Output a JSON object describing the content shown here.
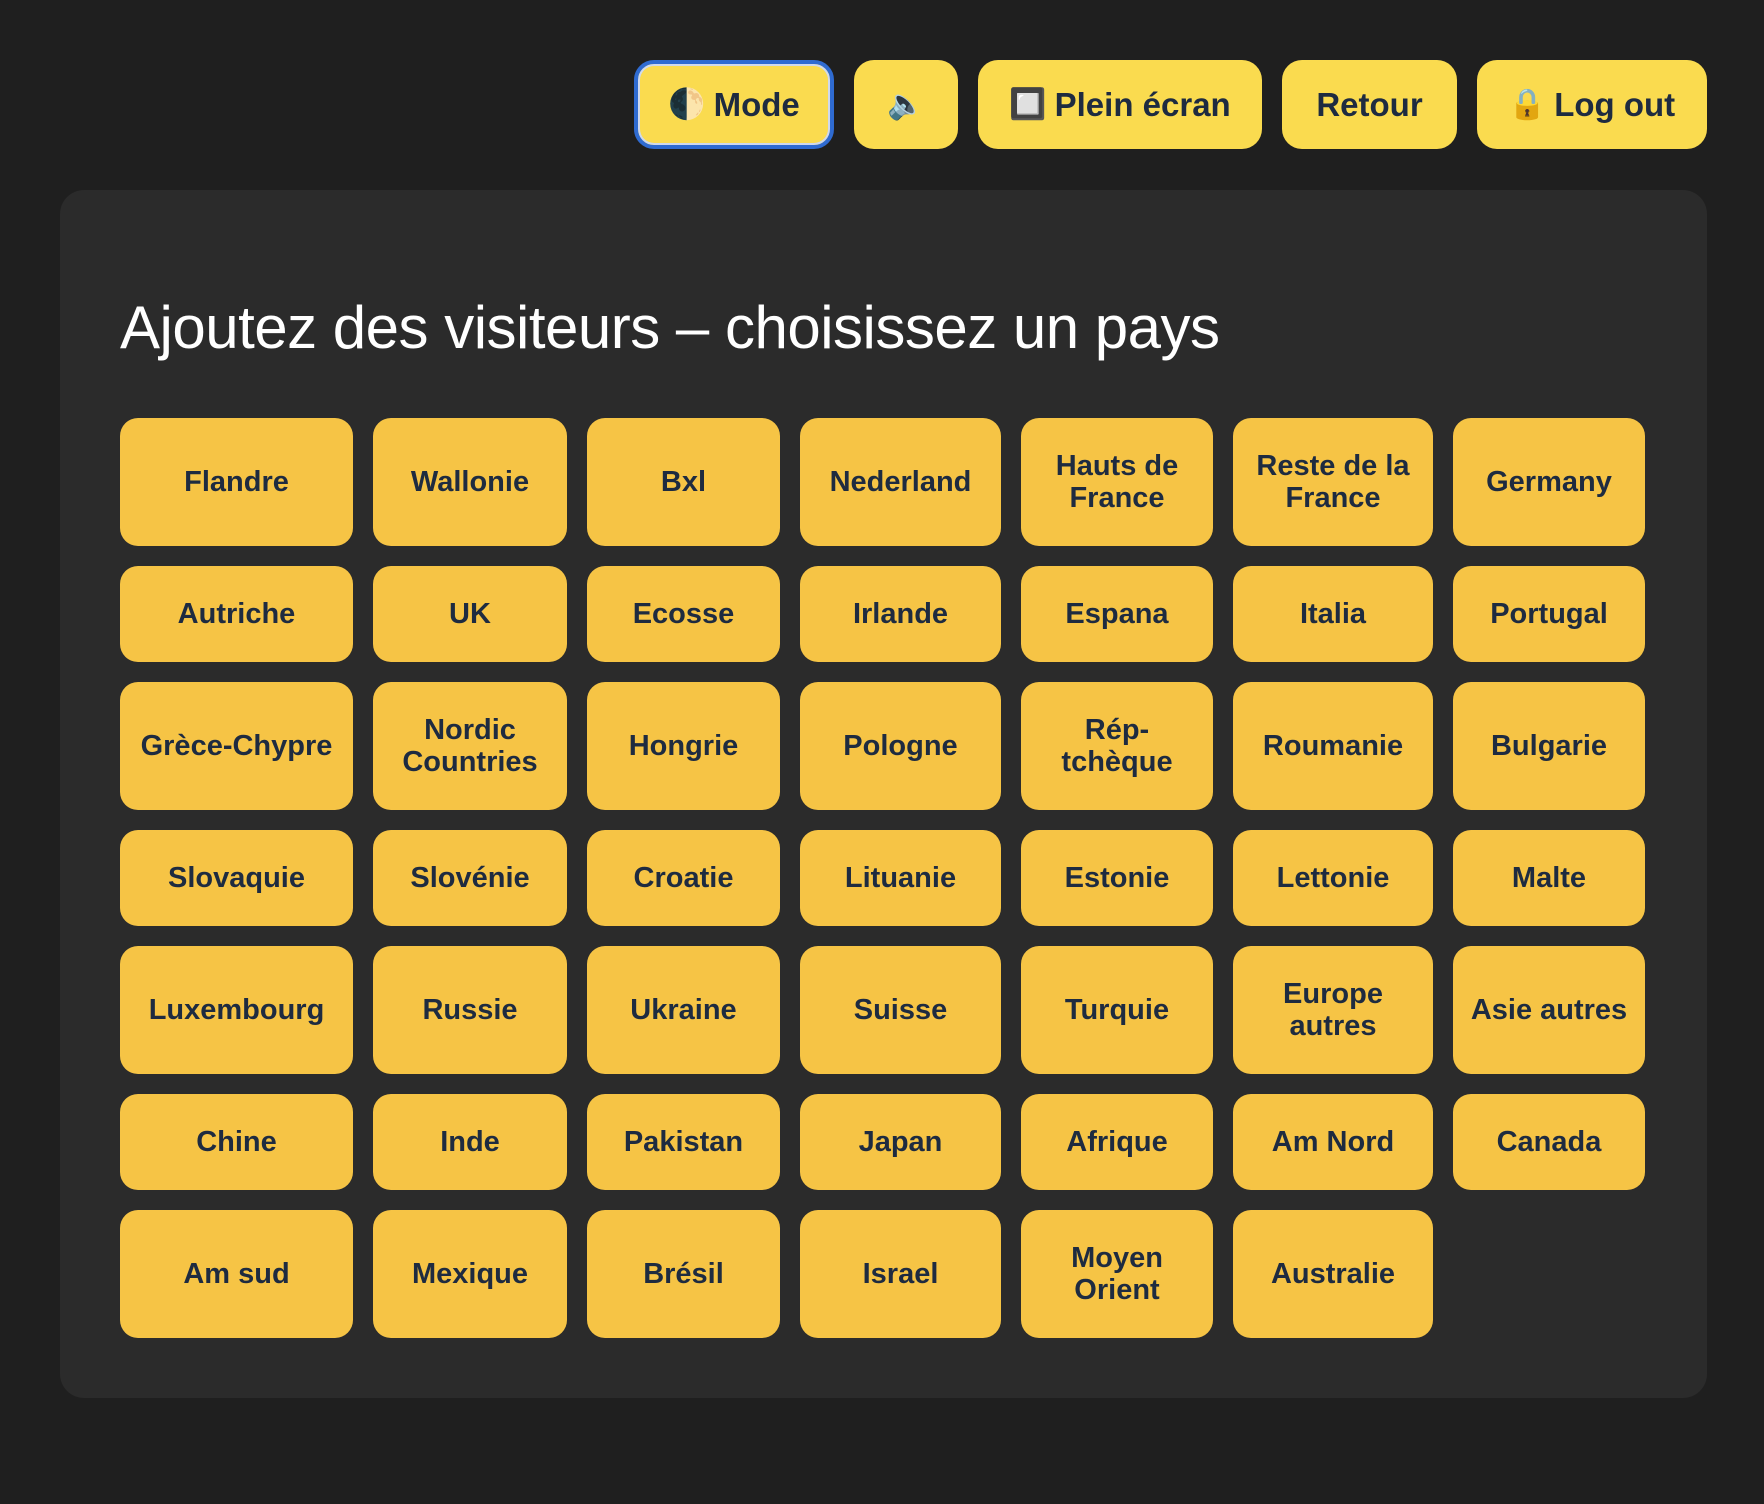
{
  "toolbar": {
    "mode": {
      "icon": "🌓",
      "icon_name": "moon-icon",
      "label": "Mode"
    },
    "sound": {
      "icon": "🔈",
      "icon_name": "speaker-icon"
    },
    "fullscreen": {
      "icon": "🔲",
      "icon_name": "square-icon",
      "label": "Plein écran"
    },
    "back": {
      "label": "Retour"
    },
    "logout": {
      "icon": "🔒",
      "icon_name": "lock-icon",
      "label": "Log out"
    }
  },
  "main": {
    "title": "Ajoutez des visiteurs – choisissez un pays",
    "countries": [
      "Flandre",
      "Wallonie",
      "Bxl",
      "Nederland",
      "Hauts de France",
      "Reste de la France",
      "Germany",
      "Autriche",
      "UK",
      "Ecosse",
      "Irlande",
      "Espana",
      "Italia",
      "Portugal",
      "Grèce-Chypre",
      "Nordic Countries",
      "Hongrie",
      "Pologne",
      "Rép-tchèque",
      "Roumanie",
      "Bulgarie",
      "Slovaquie",
      "Slovénie",
      "Croatie",
      "Lituanie",
      "Estonie",
      "Lettonie",
      "Malte",
      "Luxembourg",
      "Russie",
      "Ukraine",
      "Suisse",
      "Turquie",
      "Europe autres",
      "Asie autres",
      "Chine",
      "Inde",
      "Pakistan",
      "Japan",
      "Afrique",
      "Am Nord",
      "Canada",
      "Am sud",
      "Mexique",
      "Brésil",
      "Israel",
      "Moyen Orient",
      "Australie"
    ]
  },
  "colors": {
    "background": "#1f1f1f",
    "panel": "#2b2b2b",
    "top_button": "#fadb4f",
    "country_button": "#f6c445",
    "button_text": "#1e2b40",
    "focus_ring": "#2f6bd1"
  }
}
